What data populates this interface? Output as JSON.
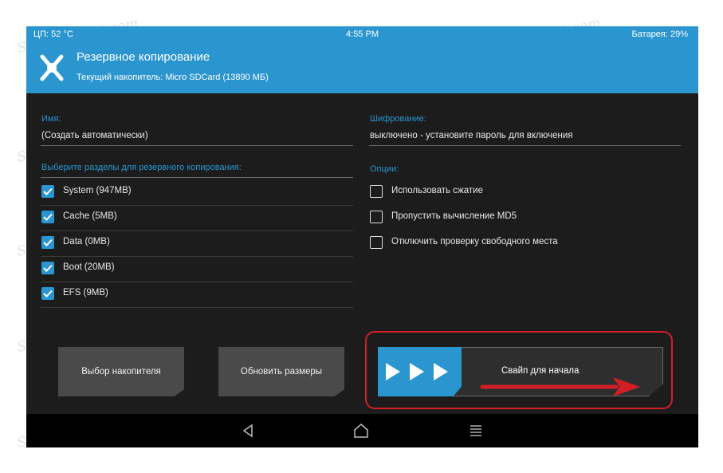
{
  "status_bar": {
    "cpu": "ЦП: 52 °C",
    "time": "4:55 PM",
    "battery": "Батарея: 29%"
  },
  "header": {
    "title": "Резервное копирование",
    "subtitle": "Текущий накопитель: Micro SDCard (13890 МБ)"
  },
  "name_section": {
    "label": "Имя:",
    "value": "(Создать автоматически)"
  },
  "partitions": {
    "label": "Выберите разделы для резервного копирования:",
    "items": [
      {
        "label": "System (947MB)",
        "checked": true
      },
      {
        "label": "Cache (5MB)",
        "checked": true
      },
      {
        "label": "Data (0MB)",
        "checked": true
      },
      {
        "label": "Boot (20MB)",
        "checked": true
      },
      {
        "label": "EFS (9MB)",
        "checked": true
      }
    ]
  },
  "encryption": {
    "label": "Шифрование:",
    "value": "выключено - установите пароль для включения"
  },
  "options": {
    "label": "Опции:",
    "items": [
      {
        "label": "Использовать сжатие",
        "checked": false
      },
      {
        "label": "Пропустить вычисление MD5",
        "checked": false
      },
      {
        "label": "Отключить проверку свободного места",
        "checked": false
      }
    ]
  },
  "buttons": {
    "select_storage": "Выбор накопителя",
    "refresh_sizes": "Обновить размеры"
  },
  "swipe": {
    "label": "Свайп для начала"
  },
  "navbar": {
    "back": "back-icon",
    "home": "home-icon",
    "menu": "menu-icon"
  },
  "watermark": "Sovietgadget.com",
  "colors": {
    "accent": "#2a95cf",
    "background": "#1c1c1c",
    "button": "#4a4a4a",
    "highlight": "#d21f26"
  }
}
